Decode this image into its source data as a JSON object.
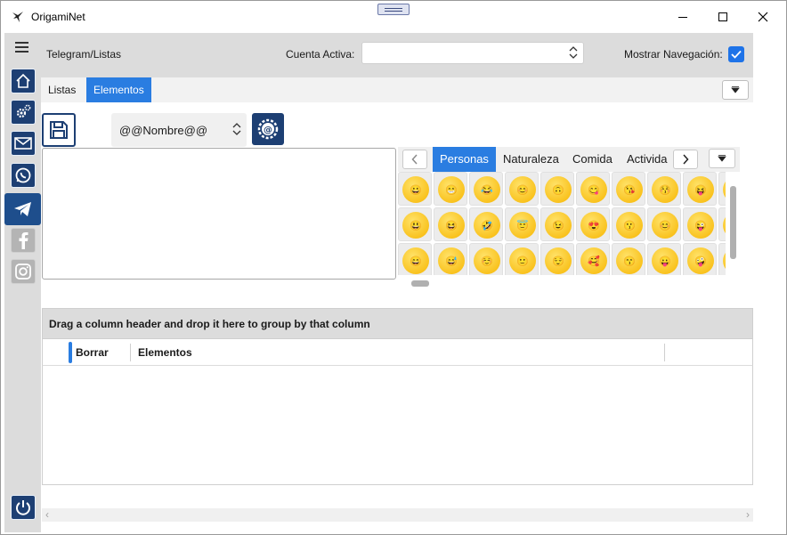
{
  "window": {
    "title": "OrigamiNet"
  },
  "header": {
    "breadcrumb": "Telegram/Listas",
    "cuenta_label": "Cuenta Activa:",
    "cuenta_value": "",
    "nav_label": "Mostrar Navegación:",
    "nav_checked": true
  },
  "sidebar": {
    "items": [
      {
        "name": "home",
        "icon": "home-icon",
        "active": false
      },
      {
        "name": "settings",
        "icon": "gears-icon",
        "active": false
      },
      {
        "name": "email",
        "icon": "mail-icon",
        "active": false
      },
      {
        "name": "whatsapp",
        "icon": "whatsapp-icon",
        "active": false
      },
      {
        "name": "telegram",
        "icon": "telegram-icon",
        "active": true
      },
      {
        "name": "facebook",
        "icon": "facebook-icon",
        "active": false
      },
      {
        "name": "instagram",
        "icon": "instagram-icon",
        "active": false
      }
    ]
  },
  "tabs": [
    {
      "label": "Listas",
      "active": false
    },
    {
      "label": "Elementos",
      "active": true
    }
  ],
  "editor": {
    "name_select": "@@Nombre@@",
    "text": ""
  },
  "emoji_panel": {
    "categories": [
      "Personas",
      "Naturaleza",
      "Comida",
      "Activida"
    ],
    "active_category": "Personas",
    "rows": [
      [
        "😀",
        "😁",
        "😂",
        "😊",
        "🙃",
        "😋",
        "😘",
        "😚",
        "😝",
        "😄"
      ],
      [
        "😃",
        "😆",
        "🤣",
        "😇",
        "😉",
        "😍",
        "😗",
        "😊",
        "😜",
        "😅"
      ],
      [
        "😄",
        "😅",
        "☺️",
        "🙂",
        "😌",
        "🥰",
        "😙",
        "😛",
        "🤪",
        "😎"
      ]
    ]
  },
  "grid": {
    "group_hint": "Drag a column header and drop it here to group by that column",
    "columns": [
      "Borrar",
      "Elementos"
    ]
  },
  "colors": {
    "accent": "#2a7de1",
    "sidebar_dark": "#1d3f73",
    "sidebar_bg": "#dcdcdc"
  }
}
